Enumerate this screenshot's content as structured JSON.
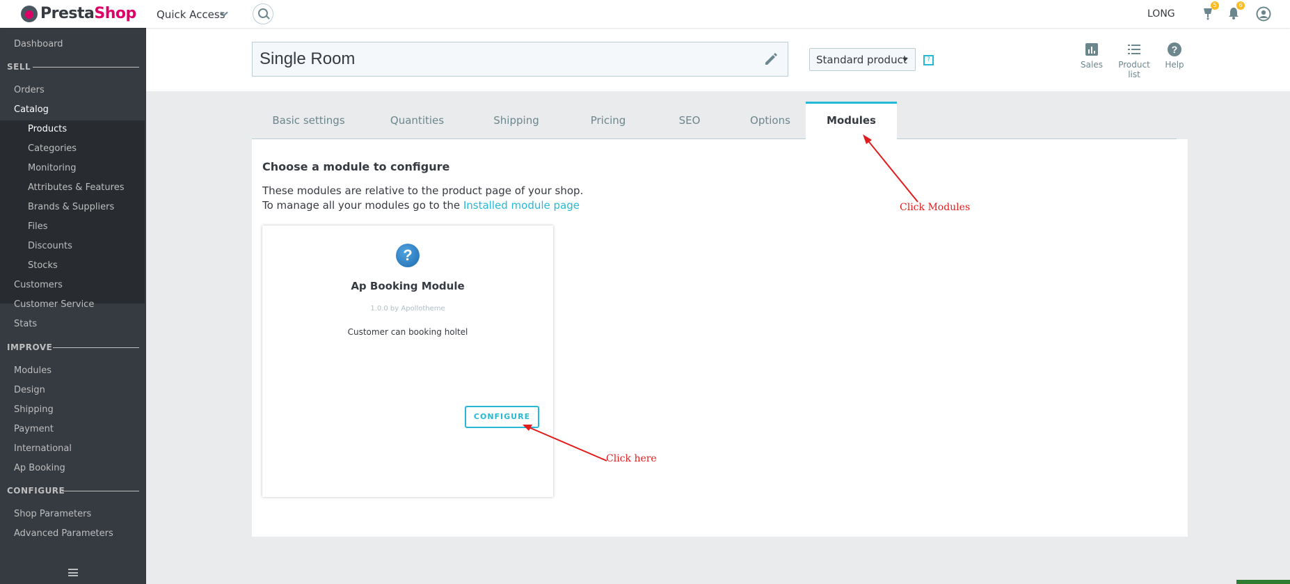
{
  "header": {
    "logo_part1": "Presta",
    "logo_part2": "Shop",
    "quick_access_label": "Quick Access",
    "user_name": "LONG",
    "orders_badge": "5",
    "notifications_badge": "6"
  },
  "sidebar": {
    "items": {
      "dashboard": "Dashboard",
      "sell_section": "SELL",
      "orders": "Orders",
      "catalog": "Catalog",
      "products": "Products",
      "categories": "Categories",
      "monitoring": "Monitoring",
      "attributes": "Attributes & Features",
      "brands": "Brands & Suppliers",
      "files": "Files",
      "discounts": "Discounts",
      "stocks": "Stocks",
      "customers": "Customers",
      "customer_service": "Customer Service",
      "stats": "Stats",
      "improve_section": "IMPROVE",
      "modules": "Modules",
      "design": "Design",
      "shipping": "Shipping",
      "payment": "Payment",
      "international": "International",
      "ap_booking": "Ap Booking",
      "configure_section": "CONFIGURE",
      "shop_parameters": "Shop Parameters",
      "advanced_parameters": "Advanced Parameters"
    }
  },
  "toolbar": {
    "product_name": "Single Room",
    "product_type": "Standard product",
    "help_mark": "?",
    "sales_label": "Sales",
    "product_list_label": "Product list",
    "help_label": "Help"
  },
  "tabs": {
    "basic_settings": "Basic settings",
    "quantities": "Quantities",
    "shipping": "Shipping",
    "pricing": "Pricing",
    "seo": "SEO",
    "options": "Options",
    "modules": "Modules"
  },
  "panel": {
    "title": "Choose a module to configure",
    "desc_line1": "These modules are relative to the product page of your shop.",
    "desc_line2_prefix": "To manage all your modules go to the ",
    "desc_link": "Installed module page"
  },
  "module_card": {
    "icon_glyph": "?",
    "name": "Ap Booking Module",
    "version": "1.0.0 by Apollotheme",
    "description": "Customer can booking holtel",
    "configure_label": "CONFIGURE"
  },
  "annotations": {
    "click_modules": "Click Modules",
    "click_here": "Click here",
    "color": "#e21c1c"
  },
  "colors": {
    "accent": "#25b9d7",
    "sidebar_bg": "#363a41",
    "sidebar_sub_bg": "#282b30",
    "brand_pink": "#df0067",
    "badge": "#fbbb22"
  }
}
